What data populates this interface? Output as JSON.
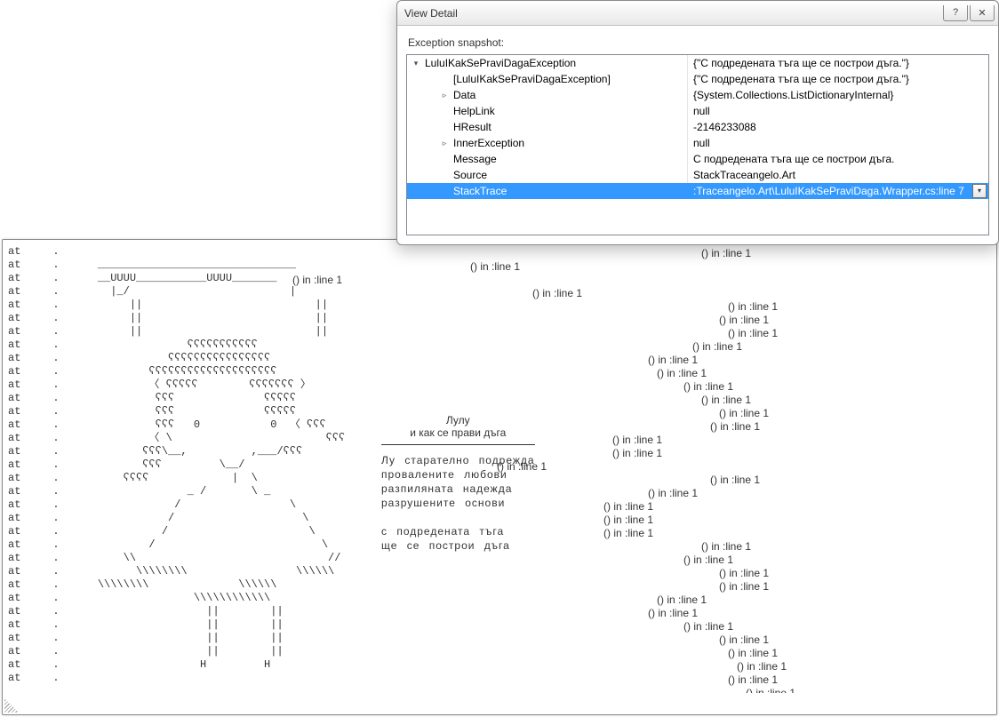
{
  "modal": {
    "title": "View Detail",
    "snapshot_label": "Exception snapshot:",
    "rows": [
      {
        "indent": 0,
        "expander": "▾",
        "name": "LuluIKakSePraviDagaException",
        "value": "{\"С подредената тъга ще се построи дъга.\"}"
      },
      {
        "indent": 1,
        "expander": "",
        "name": "[LuluIKakSePraviDagaException]",
        "value": "{\"С подредената тъга ще се построи дъга.\"}"
      },
      {
        "indent": 1,
        "expander": "▹",
        "name": "Data",
        "value": "{System.Collections.ListDictionaryInternal}"
      },
      {
        "indent": 1,
        "expander": "",
        "name": "HelpLink",
        "value": "null"
      },
      {
        "indent": 1,
        "expander": "",
        "name": "HResult",
        "value": "-2146233088"
      },
      {
        "indent": 1,
        "expander": "▹",
        "name": "InnerException",
        "value": "null"
      },
      {
        "indent": 1,
        "expander": "",
        "name": "Message",
        "value": "С подредената тъга ще се построи дъга."
      },
      {
        "indent": 1,
        "expander": "",
        "name": "Source",
        "value": "StackTraceangelo.Art"
      },
      {
        "indent": 1,
        "expander": "",
        "name": "StackTrace",
        "value": ":Traceangelo.Art\\LuluIKakSePraviDaga.Wrapper.cs:line 7",
        "selected": true,
        "dropdown": true
      }
    ]
  },
  "poem": {
    "title1": "Лулу",
    "title2": "и   как   се   прави   дъга",
    "lines": [
      "Лу   старателно   подрежда",
      "провалените   любови",
      "разпиляната   надежда",
      "разрушените   основи",
      "",
      "с   подредената   тъга",
      "ще   се   построи   дъга"
    ]
  },
  "stack_prefix": "at",
  "line_tag": "() in :line 1",
  "ascii_art": [
    "at     .",
    "at     .      _______________________________",
    "at     .      __UUUU___________UUUU_______",
    "at     .        |_/                         |",
    "at     .           ||                           ||",
    "at     .           ||                           ||",
    "at     .           ||                           ||",
    "at     .                    ʕʕʕʕʕʕʕʕʕʕʕ",
    "at     .                 ʕʕʕʕʕʕʕʕʕʕʕʕʕʕʕʕ",
    "at     .              ʕʕʕʕʕʕʕʕʕʕʕʕʕʕʕʕʕʕʕʕ",
    "at     .              〈 ʕʕʕʕʕ        ʕʕʕʕʕʕʕ 〉",
    "at     .               ʕʕʕ              ʕʕʕʕʕ",
    "at     .               ʕʕʕ              ʕʕʕʕʕ",
    "at     .               ʕʕʕ   0           0  〈 ʕʕʕ",
    "at     .              〈 \\                        ʕʕʕ",
    "at     .             ʕʕʕ\\__,          ,___/ʕʕʕ",
    "at     .             ʕʕʕ         \\__/",
    "at     .          ʕʕʕʕ             |  \\",
    "at     .                    _ /       \\ _",
    "at     .                  /                 \\",
    "at     .                 /                    \\",
    "at     .                /                      \\",
    "at     .              /                          \\",
    "at     .          \\\\                              //",
    "at     .            \\\\\\\\\\\\\\\\                 \\\\\\\\\\\\",
    "at     .      \\\\\\\\\\\\\\\\              \\\\\\\\\\\\",
    "at     .                     \\\\\\\\\\\\\\\\\\\\\\\\",
    "at     .                       ||        ||",
    "at     .                       ||        ||",
    "at     .                       ||        ||",
    "at     .                       ||        ||",
    "at     .                      H         H",
    "at     ."
  ],
  "right_line_offsets": [
    780,
    520,
    320,
    590,
    810,
    800,
    810,
    770,
    720,
    730,
    760,
    780,
    800,
    790,
    680,
    680,
    550,
    790,
    720,
    670,
    670,
    670,
    780,
    760,
    800,
    800,
    730,
    720,
    760,
    800,
    810,
    820,
    810,
    830
  ]
}
